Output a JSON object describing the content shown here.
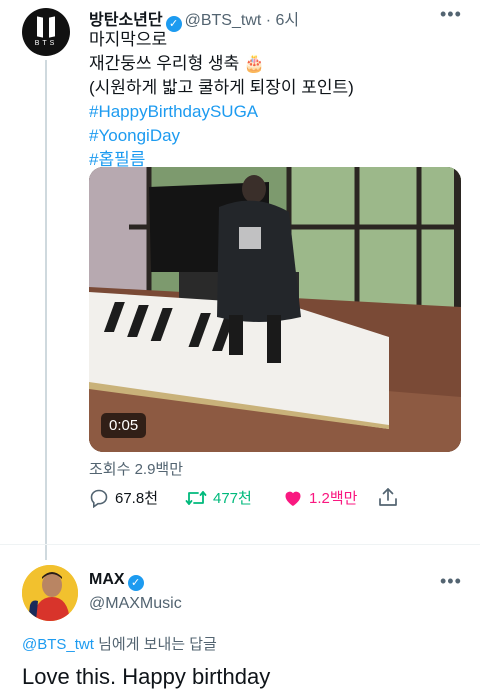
{
  "tweet": {
    "display_name": "방탄소년단",
    "handle_time": "@BTS_twt · 6시",
    "lines": [
      "마지막으로",
      "재간둥쓰 우리형 생축 🎂",
      "(시원하게 밟고 쿨하게 퇴장이 포인트)"
    ],
    "hashtags": [
      "#HappyBirthdaySUGA",
      "#YoongiDay",
      "#홉필름"
    ],
    "video_duration": "0:05",
    "views": "조회수 2.9백만",
    "replies": "67.8천",
    "retweets": "477천",
    "likes": "1.2백만"
  },
  "reply": {
    "display_name": "MAX",
    "handle": "@MAXMusic",
    "replying_to_handle": "@BTS_twt",
    "replying_to_suffix": " 님에게 보내는 답글",
    "text": "Love this. Happy birthday"
  },
  "colors": {
    "accent": "#1d9bf0",
    "retweet": "#00ba7c",
    "like": "#f91880"
  }
}
